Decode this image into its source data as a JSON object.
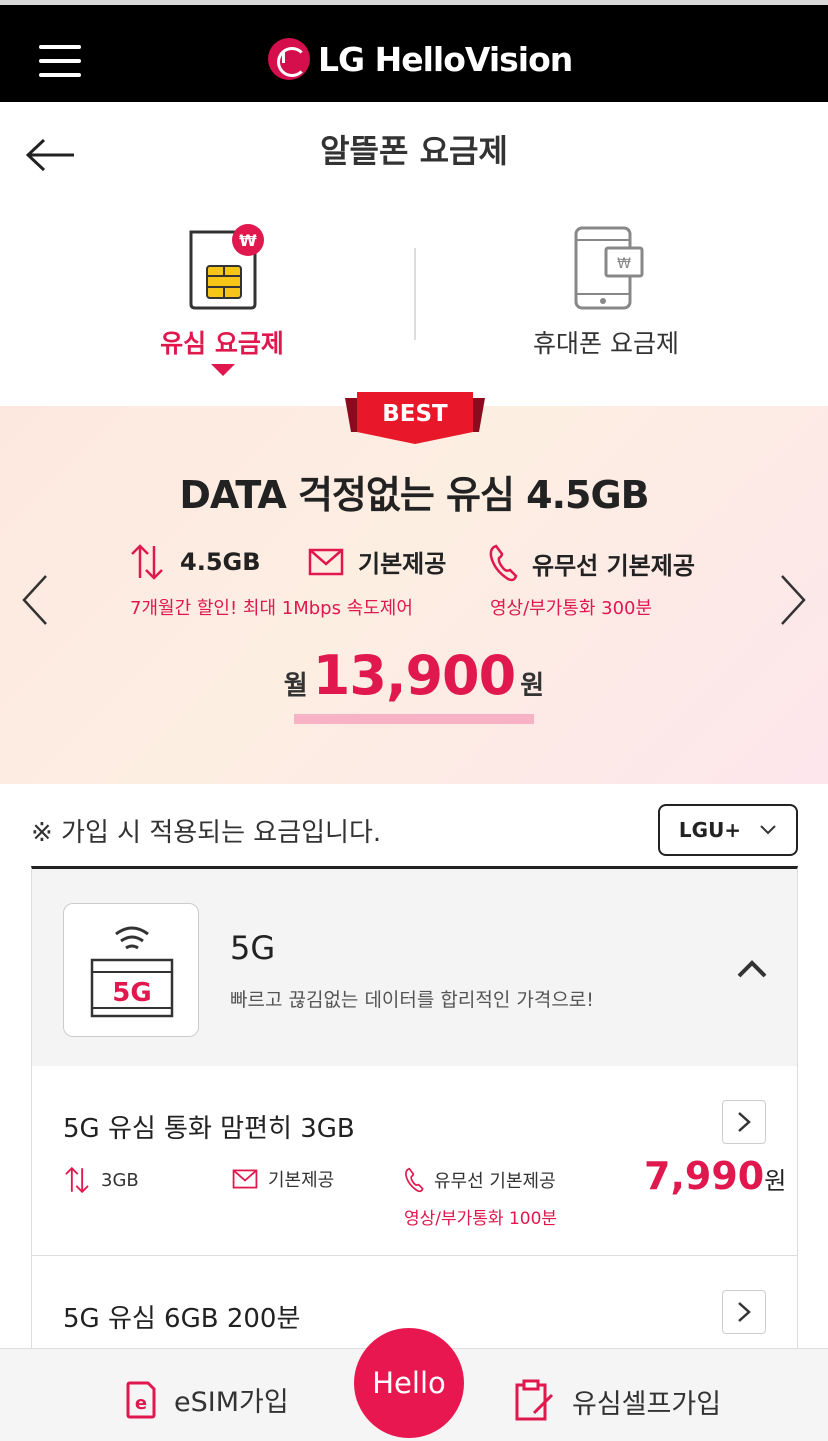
{
  "topbar": {
    "menu_icon": "hamburger-icon",
    "brand_name": "LG HelloVision",
    "brand_color": "#d40f4c"
  },
  "header": {
    "back_icon": "arrow-left-icon",
    "title": "알뜰폰 요금제"
  },
  "tabs": [
    {
      "label": "유심 요금제",
      "icon": "usim-card-icon",
      "active": true
    },
    {
      "label": "휴대폰 요금제",
      "icon": "phone-icon",
      "active": false
    }
  ],
  "banner": {
    "badge": "BEST",
    "title": "DATA 걱정없는 유심 4.5GB",
    "features": [
      {
        "icon": "data-arrows-icon",
        "label": "4.5GB"
      },
      {
        "icon": "mail-icon",
        "label": "기본제공"
      },
      {
        "icon": "phone-call-icon",
        "label": "유무선 기본제공"
      }
    ],
    "data_note": "7개월간 할인! 최대 1Mbps 속도제어",
    "call_note": "영상/부가통화 300분",
    "price_prefix": "월",
    "price": "13,900",
    "price_suffix": "원",
    "prev_icon": "chevron-left-icon",
    "next_icon": "chevron-right-icon"
  },
  "notice": "※ 가입 시 적용되는 요금입니다.",
  "carrier": {
    "selected": "LGU+"
  },
  "group": {
    "icon_label": "5G",
    "title": "5G",
    "subtitle": "빠르고 끊김없는 데이터를 합리적인 가격으로!",
    "expanded": true
  },
  "plans": [
    {
      "name": "5G 유심 통화 맘편히 3GB",
      "data": "3GB",
      "sms": "기본제공",
      "call": "유무선 기본제공",
      "call_note": "영상/부가통화 100분",
      "price": "7,990",
      "price_unit": "원"
    },
    {
      "name": "5G 유심 6GB 200분"
    }
  ],
  "bottombar": {
    "esim": "eSIM가입",
    "hello": "Hello",
    "self": "유심셀프가입"
  },
  "colors": {
    "accent": "#e0184e",
    "dark": "#000000"
  }
}
